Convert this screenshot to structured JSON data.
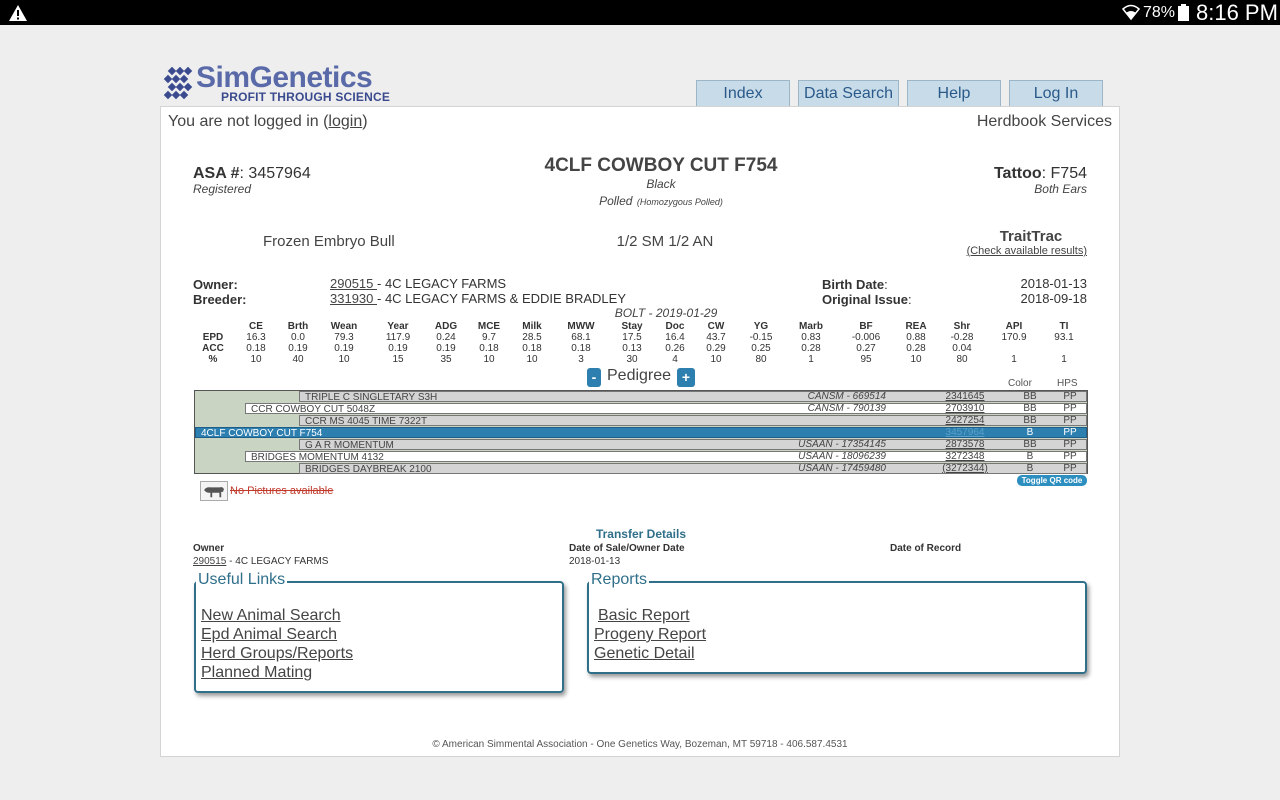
{
  "status": {
    "battery": "78%",
    "time": "8:16 PM",
    "icons": [
      "warning-icon",
      "wifi-icon",
      "battery-icon"
    ]
  },
  "logo": {
    "brand": "SimGenetics",
    "tagline": "PROFIT THROUGH SCIENCE"
  },
  "nav": [
    "Index",
    "Data Search",
    "Help",
    "Log In"
  ],
  "login": {
    "prefix": "You are not logged in (",
    "link": "login",
    "suffix": ")"
  },
  "herdbook": "Herdbook Services",
  "animal": {
    "asa_label": "ASA #",
    "asa_value": ": 3457964",
    "registered": "Registered",
    "name": "4CLF COWBOY CUT F754",
    "color": "Black",
    "polled": "Polled",
    "polled_detail": "(Homozygous Polled)",
    "tattoo_label": "Tattoo",
    "tattoo_value": ": F754",
    "tattoo_loc": "Both Ears",
    "type": "Frozen Embryo Bull",
    "breed": "1/2 SM 1/2 AN",
    "traittrac": "TraitTrac",
    "traittrac_link": "(Check available results)",
    "owner_label": "Owner:",
    "owner_id": "290515 ",
    "owner_name": "- 4C LEGACY FARMS",
    "breeder_label": "Breeder:",
    "breeder_id": "331930 ",
    "breeder_name": "- 4C LEGACY FARMS & EDDIE BRADLEY",
    "birth_label": "Birth Date",
    "birth_value": "2018-01-13",
    "issue_label": "Original Issue",
    "issue_value": "2018-09-18",
    "epd_date": "BOLT - 2019-01-29"
  },
  "epd": {
    "headers": [
      "CE",
      "Brth",
      "Wean",
      "Year",
      "ADG",
      "MCE",
      "Milk",
      "MWW",
      "Stay",
      "Doc",
      "CW",
      "YG",
      "Marb",
      "BF",
      "REA",
      "Shr",
      "API",
      "TI"
    ],
    "rows": [
      {
        "label": "EPD",
        "values": [
          "16.3",
          "0.0",
          "79.3",
          "117.9",
          "0.24",
          "9.7",
          "28.5",
          "68.1",
          "17.5",
          "16.4",
          "43.7",
          "-0.15",
          "0.83",
          "-0.006",
          "0.88",
          "-0.28",
          "170.9",
          "93.1"
        ]
      },
      {
        "label": "ACC",
        "values": [
          "0.18",
          "0.19",
          "0.19",
          "0.19",
          "0.19",
          "0.18",
          "0.18",
          "0.18",
          "0.13",
          "0.26",
          "0.29",
          "0.25",
          "0.28",
          "0.27",
          "0.28",
          "0.04",
          "",
          ""
        ]
      },
      {
        "label": "%",
        "values": [
          "10",
          "40",
          "10",
          "15",
          "35",
          "10",
          "10",
          "3",
          "30",
          "4",
          "10",
          "80",
          "1",
          "95",
          "10",
          "80",
          "1",
          "1"
        ]
      }
    ]
  },
  "pedigree": {
    "title": "Pedigree",
    "minus": "-",
    "plus": "+",
    "col_color": "Color",
    "col_hps": "HPS",
    "rows": [
      {
        "name": "TRIPLE C SINGLETARY S3H",
        "reg": "CANSM - 669514",
        "num": "2341645",
        "color": "BB",
        "hps": "PP"
      },
      {
        "name": "CCR COWBOY CUT 5048Z",
        "reg": "CANSM - 790139",
        "num": "2703910",
        "color": "BB",
        "hps": "PP"
      },
      {
        "name": "CCR MS 4045 TIME 7322T",
        "reg": "",
        "num": "2427254",
        "color": "BB",
        "hps": "PP"
      },
      {
        "name": "4CLF COWBOY CUT F754",
        "reg": "",
        "num": "3457964",
        "color": "B",
        "hps": "PP"
      },
      {
        "name": "G A R MOMENTUM",
        "reg": "USAAN - 17354145",
        "num": "2873578",
        "color": "BB",
        "hps": "PP"
      },
      {
        "name": "BRIDGES MOMENTUM 4132",
        "reg": "USAAN - 18096239",
        "num": "3272348",
        "color": "B",
        "hps": "PP"
      },
      {
        "name": "BRIDGES DAYBREAK 2100",
        "reg": "USAAN - 17459480",
        "num": "(3272344)",
        "color": "B",
        "hps": "PP"
      }
    ],
    "toggle_qr": "Toggle QR code"
  },
  "pictures": "No Pictures available",
  "transfer": {
    "title": "Transfer Details",
    "owner_label": "Owner",
    "owner_id": "290515",
    "owner_name": " - 4C LEGACY FARMS",
    "sale_label": "Date of Sale/Owner Date",
    "sale_value": "2018-01-13",
    "record_label": "Date of Record"
  },
  "useful_links": {
    "title": "Useful Links",
    "items": [
      "New Animal Search",
      "Epd Animal Search",
      "Herd Groups/Reports",
      "Planned Mating"
    ]
  },
  "reports": {
    "title": "Reports",
    "items": [
      "Basic Report",
      "Progeny Report",
      "Genetic Detail"
    ]
  },
  "footer": "© American Simmental Association - One Genetics Way, Bozeman, MT 59718 - 406.587.4531"
}
